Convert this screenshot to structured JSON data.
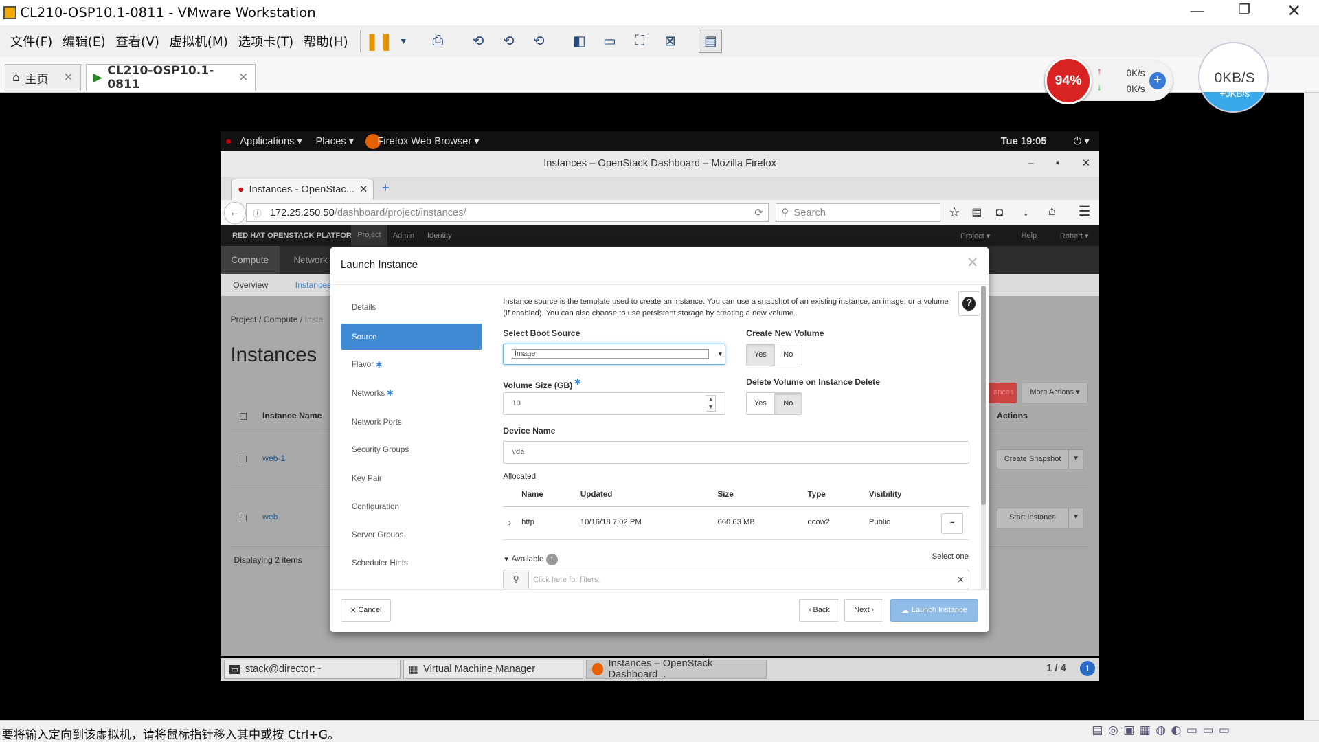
{
  "vmware": {
    "title": "CL210-OSP10.1-0811 - VMware Workstation",
    "menu": [
      "文件(F)",
      "编辑(E)",
      "查看(V)",
      "虚拟机(M)",
      "选项卡(T)",
      "帮助(H)"
    ],
    "tabs": [
      {
        "label": "主页"
      },
      {
        "label": "CL210-OSP10.1-0811"
      }
    ],
    "status": "要将输入定向到该虚拟机，请将鼠标指针移入其中或按 Ctrl+G。",
    "net_widget": {
      "cpu": "94%",
      "up": "0K/s",
      "down": "0K/s",
      "speed": "0KB/S",
      "speed_sub": "+0KB/s"
    }
  },
  "gnome": {
    "applications": "Applications",
    "places": "Places",
    "firefox": "Firefox Web Browser",
    "time": "Tue 19:05"
  },
  "firefox": {
    "window_title": "Instances – OpenStack Dashboard – Mozilla Firefox",
    "tab": "Instances - OpenStac...",
    "url_host": "172.25.250.50",
    "url_path": "/dashboard/project/instances/",
    "search_placeholder": "Search"
  },
  "openstack": {
    "brand": "RED HAT OPENSTACK PLATFORM",
    "topnav": [
      "Project",
      "Admin",
      "Identity"
    ],
    "right": [
      "Project ▾",
      "Help",
      "Robert ▾"
    ],
    "nav": [
      "Compute",
      "Network"
    ],
    "subnav": [
      "Overview",
      "Instances"
    ],
    "breadcrumb": [
      "Project /",
      "Compute /",
      "Insta"
    ],
    "page_title": "Instances",
    "col_name": "Instance Name",
    "col_actions": "Actions",
    "more_actions": "More Actions ▾",
    "launch_partial": "ances",
    "rows": [
      {
        "name": "web-1",
        "action": "Create Snapshot"
      },
      {
        "name": "web",
        "action": "Start Instance"
      }
    ],
    "displaying": "Displaying 2 items"
  },
  "taskbar": {
    "items": [
      "stack@director:~",
      "Virtual Machine Manager",
      "Instances – OpenStack Dashboard..."
    ],
    "workspace": "1 / 4",
    "badge": "1"
  },
  "modal": {
    "title": "Launch Instance",
    "steps": [
      "Details",
      "Source",
      "Flavor",
      "Networks",
      "Network Ports",
      "Security Groups",
      "Key Pair",
      "Configuration",
      "Server Groups",
      "Scheduler Hints"
    ],
    "description": "Instance source is the template used to create an instance. You can use a snapshot of an existing instance, an image, or a volume (if enabled). You can also choose to use persistent storage by creating a new volume.",
    "boot_source_label": "Select Boot Source",
    "boot_source_value": "Image",
    "create_volume_label": "Create New Volume",
    "yes": "Yes",
    "no": "No",
    "volume_size_label": "Volume Size (GB)",
    "volume_size": "10",
    "delete_volume_label": "Delete Volume on Instance Delete",
    "device_name_label": "Device Name",
    "device_name": "vda",
    "allocated_label": "Allocated",
    "columns": [
      "Name",
      "Updated",
      "Size",
      "Type",
      "Visibility"
    ],
    "allocated_row": {
      "name": "http",
      "updated": "10/16/18 7:02 PM",
      "size": "660.63 MB",
      "type": "qcow2",
      "visibility": "Public"
    },
    "available_label": "Available",
    "available_count": "1",
    "select_one": "Select one",
    "filter_placeholder": "Click here for filters.",
    "cancel": "Cancel",
    "back": "Back",
    "next": "Next",
    "launch": "Launch Instance"
  },
  "colors": {
    "primary": "#3f88d2",
    "red": "#cc0000"
  }
}
